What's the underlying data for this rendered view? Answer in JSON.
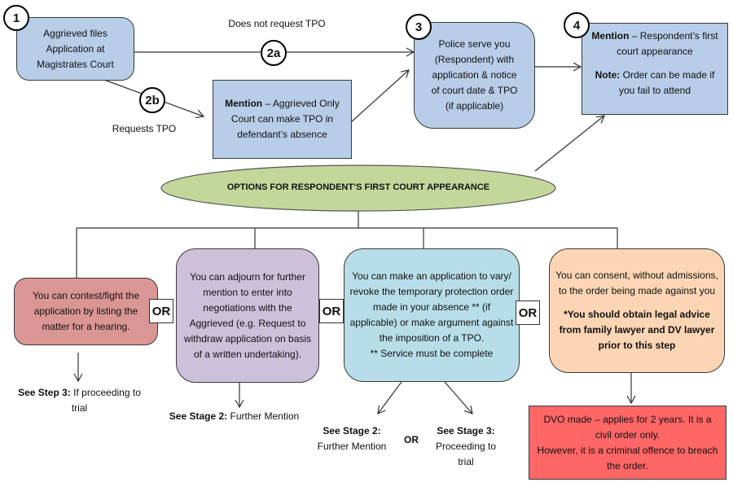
{
  "step1": {
    "badge": "1",
    "lines": [
      "Aggrieved files",
      "Application at",
      "Magistrates Court"
    ]
  },
  "path2a": {
    "badge": "2a",
    "label": "Does not request TPO"
  },
  "path2b": {
    "badge": "2b",
    "label": "Requests TPO"
  },
  "mention_aggrieved": {
    "bold": "Mention",
    "rest": " – Aggrieved Only",
    "line2": "Court can make TPO in defendant’s absence"
  },
  "step3": {
    "badge": "3",
    "lines": [
      "Police serve you",
      "(Respondent) with",
      "application & notice",
      "of court date & TPO",
      "(if applicable)"
    ]
  },
  "step4": {
    "badge": "4",
    "bold": "Mention",
    "rest": " – Respondent’s first court appearance",
    "note_bold": "Note:",
    "note_rest": " Order can be made if you fail to attend"
  },
  "options_title": "OPTIONS FOR RESPONDENT’S FIRST COURT APPEARANCE",
  "options": {
    "contest": "You can contest/fight the application by listing the matter for a hearing.",
    "adjourn": "You can adjourn for further mention to enter into negotiations with the Aggrieved (e.g. Request to withdraw application on basis of a written undertaking).",
    "vary": "You can make an application to vary/ revoke the temporary protection order made in your absence ** (if applicable) or make argument against the imposition of a TPO.",
    "vary_note": "** Service must be complete",
    "consent": "You can consent, without admissions, to the order being made against you",
    "consent_bold": "*You should obtain legal advice from family lawyer and DV lawyer prior to this step"
  },
  "or_label": "OR",
  "outcomes": {
    "contest_bold": "See Step 3:",
    "contest_rest": " If proceeding to trial",
    "adjourn_bold": "See Stage 2:",
    "adjourn_rest": " Further Mention",
    "vary_a_bold": "See Stage 2:",
    "vary_a_rest": "Further Mention",
    "vary_b_bold": "See Stage 3:",
    "vary_b_rest": "Proceeding to trial",
    "dvo_line1": "DVO made – applies for 2 years. It is a civil order only.",
    "dvo_line2": "However, it is a criminal offence to breach the order."
  },
  "colors": {
    "blue": "#b8cde8",
    "green": "#c4d79b",
    "red": "#da9694",
    "purple": "#ccc0da",
    "cyan": "#b7dee8",
    "orange": "#fcd5b4",
    "dvo_red": "#ff6666"
  }
}
